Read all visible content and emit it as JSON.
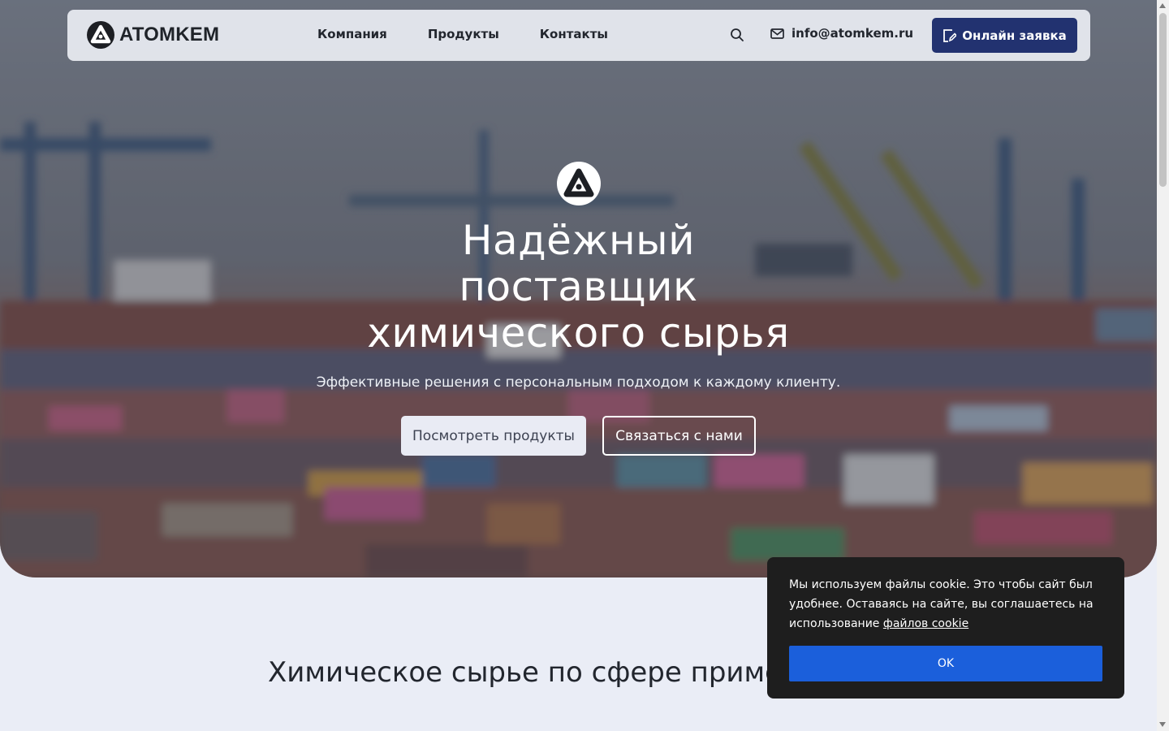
{
  "header": {
    "logo_text": "ATOMKEM",
    "nav": [
      "Компания",
      "Продукты",
      "Контакты"
    ],
    "email": "info@atomkem.ru",
    "cta_label": "Онлайн заявка"
  },
  "hero": {
    "title_lines": [
      "Надёжный",
      "поставщик",
      "химического сырья"
    ],
    "subtitle": "Эффективные решения с персональным подходом к каждому клиенту.",
    "primary_button": "Посмотреть продукты",
    "secondary_button": "Связаться с нами"
  },
  "section": {
    "title": "Химическое сырье по сфере применения"
  },
  "cookie": {
    "text": "Мы используем файлы cookie. Это чтобы сайт был удобнее. Оставаясь на сайте, вы соглашаетесь на использование ",
    "link_text": "файлов cookie",
    "ok_label": "OK"
  },
  "colors": {
    "accent": "#223270",
    "cookie_button": "#1b5fdb",
    "page_bg": "#eaedf6"
  },
  "icons": [
    "atomkem-logo-icon",
    "search-icon",
    "mail-icon",
    "request-form-icon"
  ]
}
